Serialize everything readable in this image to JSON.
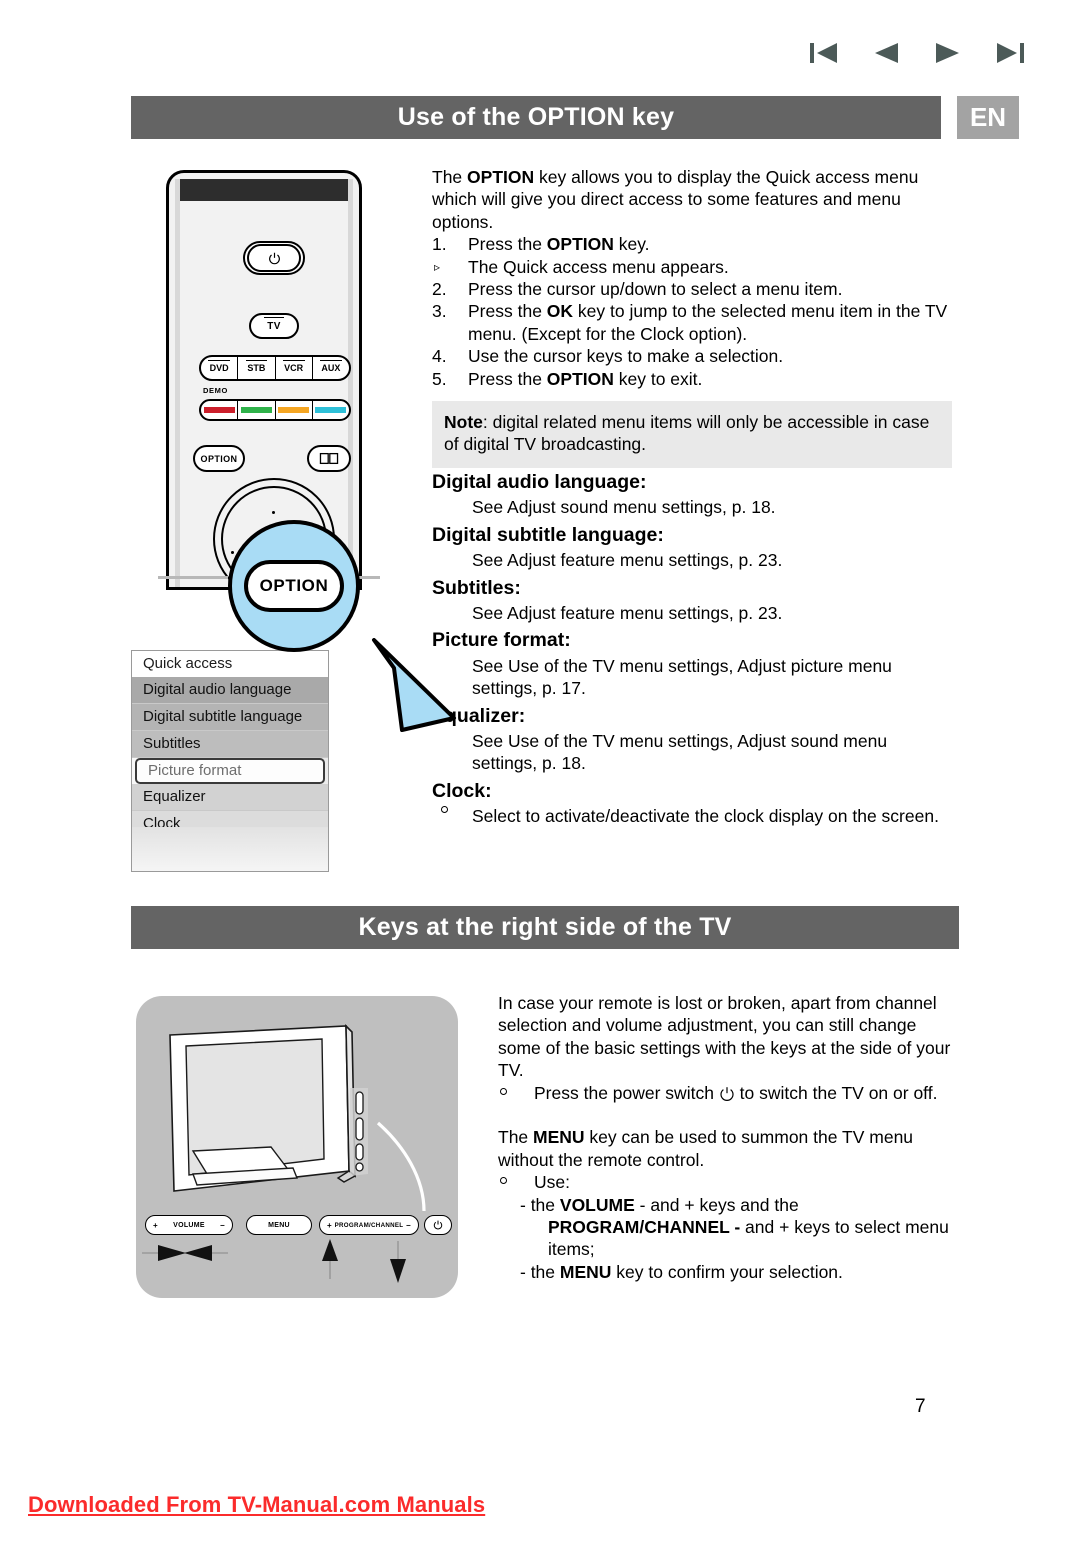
{
  "topnav": {
    "buttons": [
      {
        "name": "first-page",
        "glyph": "skip-back-icon"
      },
      {
        "name": "previous-page",
        "glyph": "play-back-icon"
      },
      {
        "name": "next-page",
        "glyph": "play-forward-icon"
      },
      {
        "name": "last-page",
        "glyph": "skip-forward-icon"
      }
    ],
    "color": "#4c5a58"
  },
  "section1": {
    "title": "Use of the OPTION key",
    "lang_badge": "EN",
    "header_bg": "#646464",
    "badge_bg": "#a3a3a3",
    "intro": {
      "line1_pre": "The ",
      "line1_bold": "OPTION",
      "line1_post": " key allows you to display the Quick access menu which will give you direct access to some features and menu options."
    },
    "steps": [
      {
        "num": "1.",
        "pre": "Press the ",
        "bold": "OPTION",
        "post": " key."
      },
      {
        "num": "2.",
        "pre": "Press the cursor up/down to select a menu item.",
        "bold": "",
        "post": ""
      },
      {
        "num": "3.",
        "pre": "Press the ",
        "bold": "OK",
        "post": " key to jump to the selected menu item in the TV menu. (Except for the Clock option)."
      },
      {
        "num": "4.",
        "pre": "Use the cursor keys to make a selection.",
        "bold": "",
        "post": ""
      },
      {
        "num": "5.",
        "pre": "Press the ",
        "bold": "OPTION",
        "post": " key to exit."
      }
    ],
    "substep": "The Quick access menu appears.",
    "note": {
      "label": "Note",
      "text": ": digital related menu items will only be accessible in case of digital TV broadcasting.",
      "bg": "#e9e9e9"
    },
    "definitions": [
      {
        "term": "Digital audio language:",
        "desc": "See Adjust sound menu settings, p. 18.",
        "bullet": false
      },
      {
        "term": "Digital subtitle language:",
        "desc": "See Adjust feature menu settings, p. 23.",
        "bullet": false
      },
      {
        "term": "Subtitles:",
        "desc": "See Adjust feature menu settings, p. 23.",
        "bullet": false
      },
      {
        "term": "Picture format:",
        "desc": "See Use of the TV menu settings, Adjust picture menu settings, p. 17.",
        "bullet": false
      },
      {
        "term": "Equalizer:",
        "desc": "See Use of the TV menu settings, Adjust sound menu settings, p. 18.",
        "bullet": false
      },
      {
        "term": "Clock:",
        "desc": "Select to activate/deactivate the clock display on the screen.",
        "bullet": true
      }
    ]
  },
  "remote": {
    "power_key": "power-icon",
    "tv_key": "TV",
    "device_keys": [
      "DVD",
      "STB",
      "VCR",
      "AUX"
    ],
    "demo_label": "DEMO",
    "color_keys": [
      "#cc1f2b",
      "#2fb24a",
      "#f5a623",
      "#2ec0d8"
    ],
    "option_key": "OPTION",
    "book_key": "book-icon",
    "callout_label": "OPTION",
    "callout_bg": "#a9dcf5"
  },
  "quick_access": {
    "title": "Quick access",
    "items": [
      {
        "label": "Digital audio language",
        "selected": false
      },
      {
        "label": "Digital subtitle language",
        "selected": false
      },
      {
        "label": "Subtitles",
        "selected": false
      },
      {
        "label": "Picture format",
        "selected": true
      },
      {
        "label": "Equalizer",
        "selected": false
      },
      {
        "label": "Clock",
        "selected": false
      }
    ]
  },
  "section2": {
    "title": "Keys at the right side of the TV",
    "para1": "In case your remote is lost or broken, apart from channel selection and volume adjustment, you can still change some of the basic settings with the keys at the side of your TV.",
    "bullet1_pre": "Press the power switch ",
    "bullet1_post": " to switch the TV on or off.",
    "para2_pre": "The ",
    "para2_bold": "MENU",
    "para2_post": " key can be used to summon the TV menu without the remote control.",
    "bullet2": "Use:",
    "sub1_pre": "- the ",
    "sub1_bold": "VOLUME",
    "sub1_mid": " - and + keys and the",
    "sub2_bold": "PROGRAM/CHANNEL -",
    "sub2_post": " and +  keys to select menu",
    "sub2_cont": "items;",
    "sub3_pre": "- the ",
    "sub3_bold": "MENU",
    "sub3_post": " key to confirm your selection."
  },
  "tv_keys": {
    "volume": {
      "label": "VOLUME",
      "plus": "+",
      "minus": "−"
    },
    "menu": {
      "label": "MENU"
    },
    "program": {
      "label": "PROGRAM/CHANNEL",
      "plus": "+",
      "minus": "−"
    },
    "power": {
      "label": "power-icon"
    },
    "panel_bg": "#bfbfbf"
  },
  "page_number": "7",
  "footer": {
    "text": "Downloaded From TV-Manual.com Manuals",
    "color": "#fb2b2b"
  }
}
